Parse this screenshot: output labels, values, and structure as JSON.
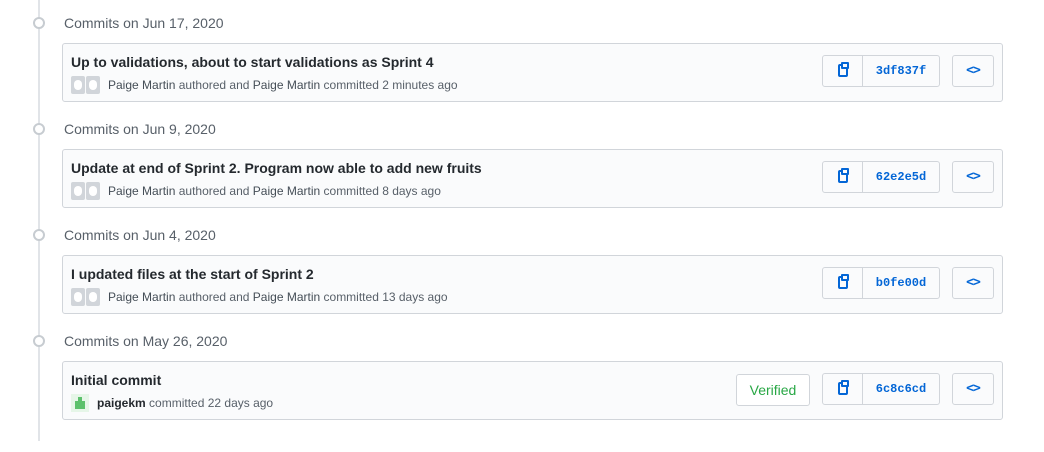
{
  "groups": [
    {
      "title": "Commits on Jun 17, 2020",
      "commit": {
        "message": "Up to validations, about to start validations as Sprint 4",
        "author": "Paige Martin",
        "authored_text": "authored and",
        "committer": "Paige Martin",
        "committed_text": "committed 2 minutes ago",
        "sha": "3df837f"
      }
    },
    {
      "title": "Commits on Jun 9, 2020",
      "commit": {
        "message": "Update at end of Sprint 2. Program now able to add new fruits",
        "author": "Paige Martin",
        "authored_text": "authored and",
        "committer": "Paige Martin",
        "committed_text": "committed 8 days ago",
        "sha": "62e2e5d"
      }
    },
    {
      "title": "Commits on Jun 4, 2020",
      "commit": {
        "message": "I updated files at the start of Sprint 2",
        "author": "Paige Martin",
        "authored_text": "authored and",
        "committer": "Paige Martin",
        "committed_text": "committed 13 days ago",
        "sha": "b0fe00d"
      }
    },
    {
      "title": "Commits on May 26, 2020",
      "commit": {
        "message": "Initial commit",
        "username": "paigekm",
        "committed_text": "committed 22 days ago",
        "verified_label": "Verified",
        "sha": "6c8c6cd"
      }
    }
  ],
  "icons": {
    "copy": "clippy-icon",
    "browse": "code-icon",
    "browse_glyph": "<>"
  },
  "colors": {
    "link": "#0366d6",
    "verified": "#28a745",
    "border": "#d1d5da"
  }
}
